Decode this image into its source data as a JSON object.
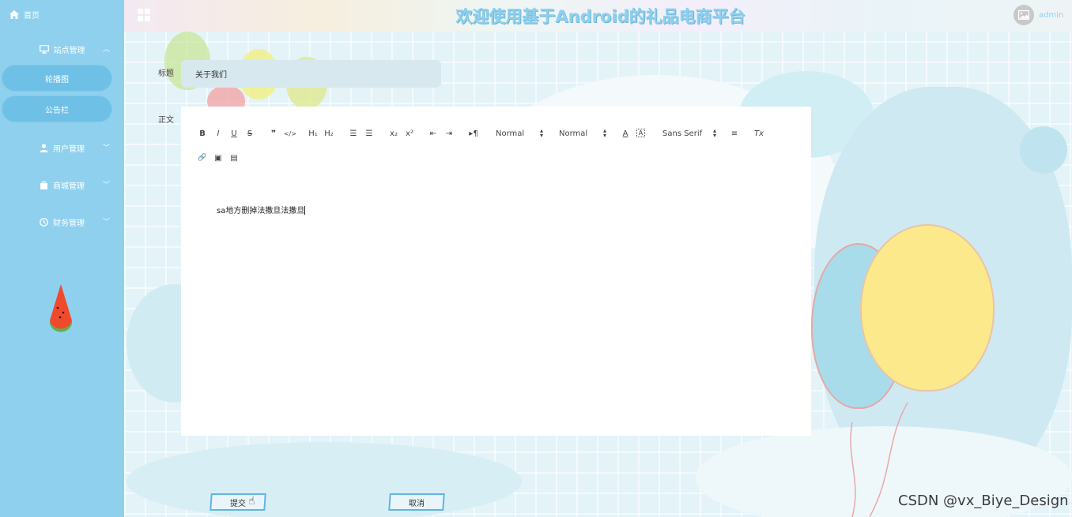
{
  "app": {
    "title": "欢迎使用基于Android的礼品电商平台",
    "user": "admin"
  },
  "sidebar": {
    "home": "首页",
    "groups": [
      {
        "label": "站点管理",
        "icon": "monitor-icon",
        "expanded": true,
        "items": [
          "轮播图",
          "公告栏"
        ]
      },
      {
        "label": "用户管理",
        "icon": "user-icon",
        "expanded": false
      },
      {
        "label": "商城管理",
        "icon": "bag-icon",
        "expanded": false
      },
      {
        "label": "财务管理",
        "icon": "clock-icon",
        "expanded": false
      }
    ]
  },
  "form": {
    "title_label": "标题",
    "title_value": "关于我们",
    "body_label": "正文",
    "body_text": "sa地方删掉法撒旦法撒旦"
  },
  "toolbar": {
    "bold": "B",
    "italic": "I",
    "underline": "U",
    "strike": "S",
    "blockquote": "❞",
    "code": "</>",
    "h1": "H₁",
    "h2": "H₂",
    "ordered_list": "☰",
    "bullet_list": "☰",
    "subscript": "x₂",
    "superscript": "x²",
    "outdent": "⇤",
    "indent": "⇥",
    "rtl": "▸¶",
    "size_select": "Normal",
    "header_select": "Normal",
    "color": "A",
    "background": "A",
    "font_select": "Sans Serif",
    "align": "≡",
    "clean": "Tx",
    "link": "🔗",
    "image": "▣",
    "video": "▤"
  },
  "buttons": {
    "submit": "提交",
    "cancel": "取消"
  },
  "watermark": "CSDN @vx_Biye_Design",
  "colors": {
    "sidebar": "#8fd0ee",
    "sidebar_active": "#6ec0e6",
    "accent": "#5fb6e0"
  }
}
